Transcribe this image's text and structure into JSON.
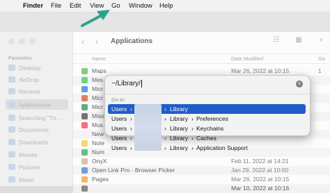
{
  "menubar": {
    "apple": "",
    "app": "Finder",
    "items": [
      "File",
      "Edit",
      "View",
      "Go",
      "Window",
      "Help"
    ]
  },
  "toolbar": {
    "title": "Applications",
    "back": "‹",
    "forward": "›",
    "view_icon": "☷",
    "group_icon": "▦",
    "more_icon": "»"
  },
  "columns": {
    "name": "Name",
    "date": "Date Modified",
    "size": "Siz"
  },
  "sidebar": {
    "section": "Favorites",
    "items": [
      {
        "label": "Desktop"
      },
      {
        "label": "AirDrop"
      },
      {
        "label": "Recents"
      },
      {
        "label": "Applications"
      },
      {
        "label": "Searching \"Th..."
      },
      {
        "label": "Documents"
      },
      {
        "label": "Downloads"
      },
      {
        "label": "Movies"
      },
      {
        "label": "Pictures"
      },
      {
        "label": "Music"
      }
    ]
  },
  "files": [
    {
      "name": "Maps",
      "date": "Mar 26, 2022 at 10:15",
      "size": "1",
      "color": "#5cb85c"
    },
    {
      "name": "Mes",
      "date": "",
      "size": "",
      "color": "#35c759"
    },
    {
      "name": "Micr",
      "date": "",
      "size": "",
      "color": "#2b7cd3"
    },
    {
      "name": "Micr",
      "date": "",
      "size": "",
      "color": "#d9532c"
    },
    {
      "name": "Micr",
      "date": "",
      "size": "",
      "color": "#2a8f5a"
    },
    {
      "name": "Miss",
      "date": "",
      "size": "",
      "color": "#444444"
    },
    {
      "name": "Mus",
      "date": "",
      "size": "",
      "color": "#fa3c4c"
    },
    {
      "name": "New",
      "date": "",
      "size": "",
      "color": "#eeeeee"
    },
    {
      "name": "Note",
      "date": "",
      "size": "",
      "color": "#f5c842"
    },
    {
      "name": "Num",
      "date": "",
      "size": "",
      "color": "#34a853"
    },
    {
      "name": "OnyX",
      "date": "Feb 11, 2022 at 14:21",
      "size": "",
      "color": "#c9b28a"
    },
    {
      "name": "Open Link Pro - Browser Picker",
      "date": "Jan 29, 2022 at 10:00",
      "size": "",
      "color": "#3b7dd8"
    },
    {
      "name": "Pages",
      "date": "Mar 26, 2022 at 10:15",
      "size": "",
      "color": "#f0a030"
    },
    {
      "name": "",
      "date": "Mar 10, 2022 at 10:16",
      "size": "",
      "color": "#888888"
    }
  ],
  "dialog": {
    "input_value": "~/Library/",
    "clear_icon": "×",
    "label": "Go to:",
    "suggestions": [
      {
        "users": "Users",
        "sep1": "›",
        "sep2": "›",
        "library": "Library",
        "sep3": "",
        "leaf": ""
      },
      {
        "users": "Users",
        "sep1": "›",
        "sep2": "›",
        "library": "Library",
        "sep3": "›",
        "leaf": "Preferences"
      },
      {
        "users": "Users",
        "sep1": "›",
        "sep2": "›",
        "library": "Library",
        "sep3": "›",
        "leaf": "Keychains"
      },
      {
        "users": "Users",
        "sep1": "›",
        "sep2": "›",
        "library": "Library",
        "sep3": "›",
        "leaf": "Caches"
      },
      {
        "users": "Users",
        "sep1": "›",
        "sep2": "›",
        "library": "Library",
        "sep3": "›",
        "leaf": "Application Support"
      }
    ]
  },
  "colors": {
    "selection": "#1f5ec8",
    "arrow": "#2aa48a"
  }
}
